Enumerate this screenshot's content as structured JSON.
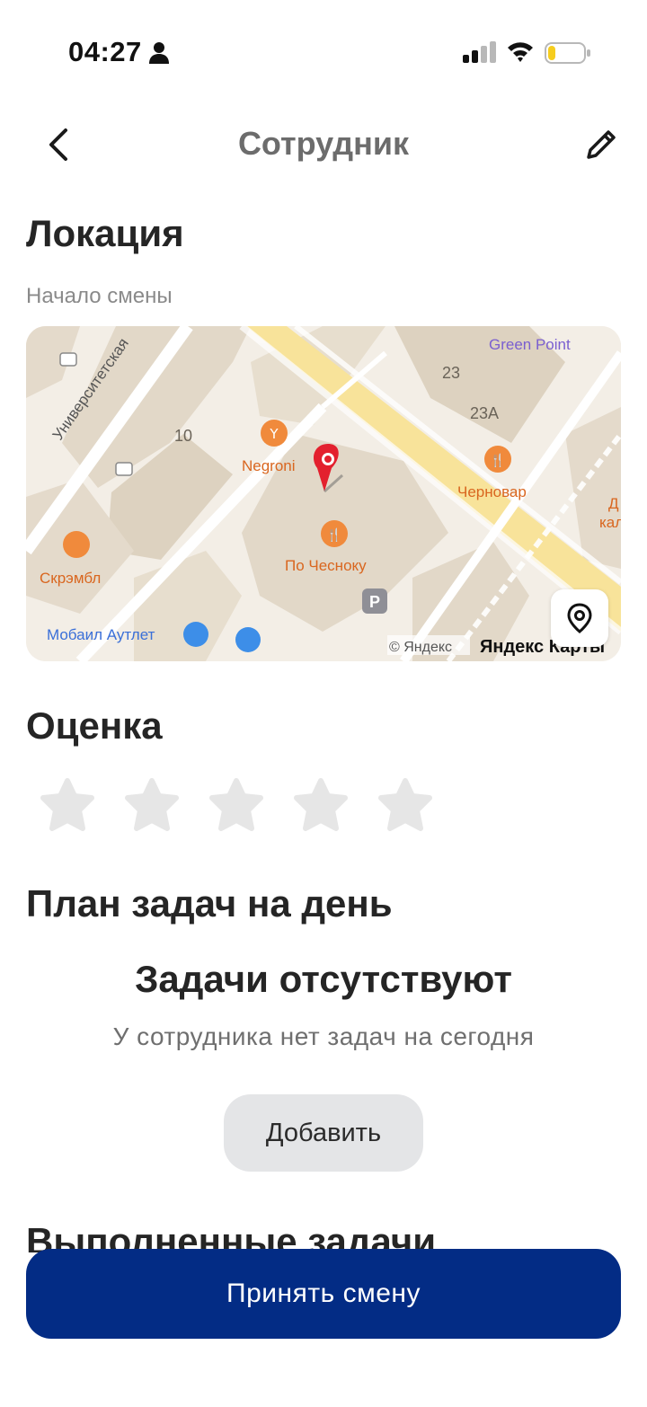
{
  "status_bar": {
    "time": "04:27"
  },
  "header": {
    "title": "Сотрудник"
  },
  "location": {
    "title": "Локация",
    "subtitle": "Начало смены",
    "map": {
      "labels": {
        "street": "Университетская",
        "green_point": "Green Point",
        "house_23": "23",
        "house_23a": "23А",
        "house_10": "10",
        "negroni": "Negroni",
        "chernovar": "Черновар",
        "d_cal": "Д",
        "d_cal2": "кал",
        "skrembl": "Скрэмбл",
        "po_chesnoku": "По Чесноку",
        "parking": "P",
        "mobile_outlet": "Мобаил Аутлет",
        "copyright": "© Яндекс",
        "brand": "Яндекс Карты"
      }
    }
  },
  "rating": {
    "title": "Оценка",
    "value": 0,
    "max": 5
  },
  "plan": {
    "title": "План задач на день",
    "empty_title": "Задачи отсутствуют",
    "empty_description": "У сотрудника нет задач на сегодня",
    "add_label": "Добавить"
  },
  "done": {
    "title": "Выполненные задачи"
  },
  "footer": {
    "accept_label": "Принять смену"
  },
  "colors": {
    "primary": "#032c85",
    "star_empty": "#e6e6e6",
    "accent_orange": "#f08a3c",
    "pin_red": "#e3202e"
  }
}
